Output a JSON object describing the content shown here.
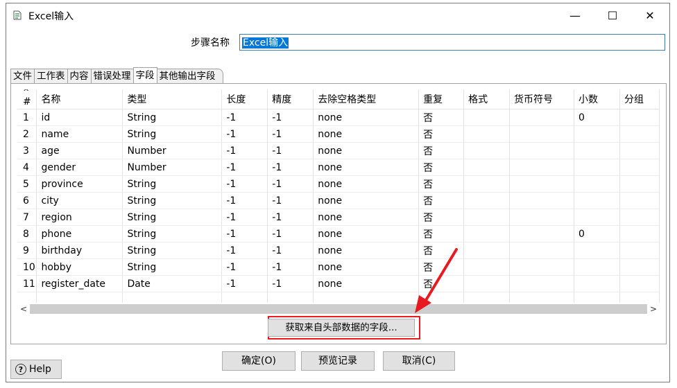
{
  "window": {
    "title": "Excel输入",
    "minimize": "—",
    "maximize": "☐",
    "close": "✕"
  },
  "step": {
    "label": "步骤名称",
    "value": "Excel输入"
  },
  "tabs": [
    {
      "label": "文件"
    },
    {
      "label": "工作表"
    },
    {
      "label": "内容"
    },
    {
      "label": "错误处理"
    },
    {
      "label": "字段",
      "active": true
    },
    {
      "label": "其他输出字段"
    }
  ],
  "table": {
    "columns": [
      "#",
      "名称",
      "类型",
      "长度",
      "精度",
      "去除空格类型",
      "重复",
      "格式",
      "货币符号",
      "小数",
      "分组"
    ],
    "sort_indicator": "^",
    "rows": [
      [
        "1",
        "id",
        "String",
        "-1",
        "-1",
        "none",
        "否",
        "",
        "",
        "0",
        ""
      ],
      [
        "2",
        "name",
        "String",
        "-1",
        "-1",
        "none",
        "否",
        "",
        "",
        "",
        ""
      ],
      [
        "3",
        "age",
        "Number",
        "-1",
        "-1",
        "none",
        "否",
        "",
        "",
        "",
        ""
      ],
      [
        "4",
        "gender",
        "Number",
        "-1",
        "-1",
        "none",
        "否",
        "",
        "",
        "",
        ""
      ],
      [
        "5",
        "province",
        "String",
        "-1",
        "-1",
        "none",
        "否",
        "",
        "",
        "",
        ""
      ],
      [
        "6",
        "city",
        "String",
        "-1",
        "-1",
        "none",
        "否",
        "",
        "",
        "",
        ""
      ],
      [
        "7",
        "region",
        "String",
        "-1",
        "-1",
        "none",
        "否",
        "",
        "",
        "",
        ""
      ],
      [
        "8",
        "phone",
        "String",
        "-1",
        "-1",
        "none",
        "否",
        "",
        "",
        "0",
        ""
      ],
      [
        "9",
        "birthday",
        "String",
        "-1",
        "-1",
        "none",
        "否",
        "",
        "",
        "",
        ""
      ],
      [
        "10",
        "hobby",
        "String",
        "-1",
        "-1",
        "none",
        "否",
        "",
        "",
        "",
        ""
      ],
      [
        "11",
        "register_date",
        "Date",
        "-1",
        "-1",
        "none",
        "否",
        "",
        "",
        "",
        ""
      ]
    ]
  },
  "scroll": {
    "left": "<",
    "right": ">"
  },
  "buttons": {
    "get_fields": "获取来自头部数据的字段...",
    "help": "Help",
    "help_icon": "?",
    "ok": "确定(O)",
    "preview": "预览记录",
    "cancel": "取消(C)"
  },
  "colors": {
    "highlight_red": "#e8191f",
    "selection_blue": "#0078d7"
  }
}
